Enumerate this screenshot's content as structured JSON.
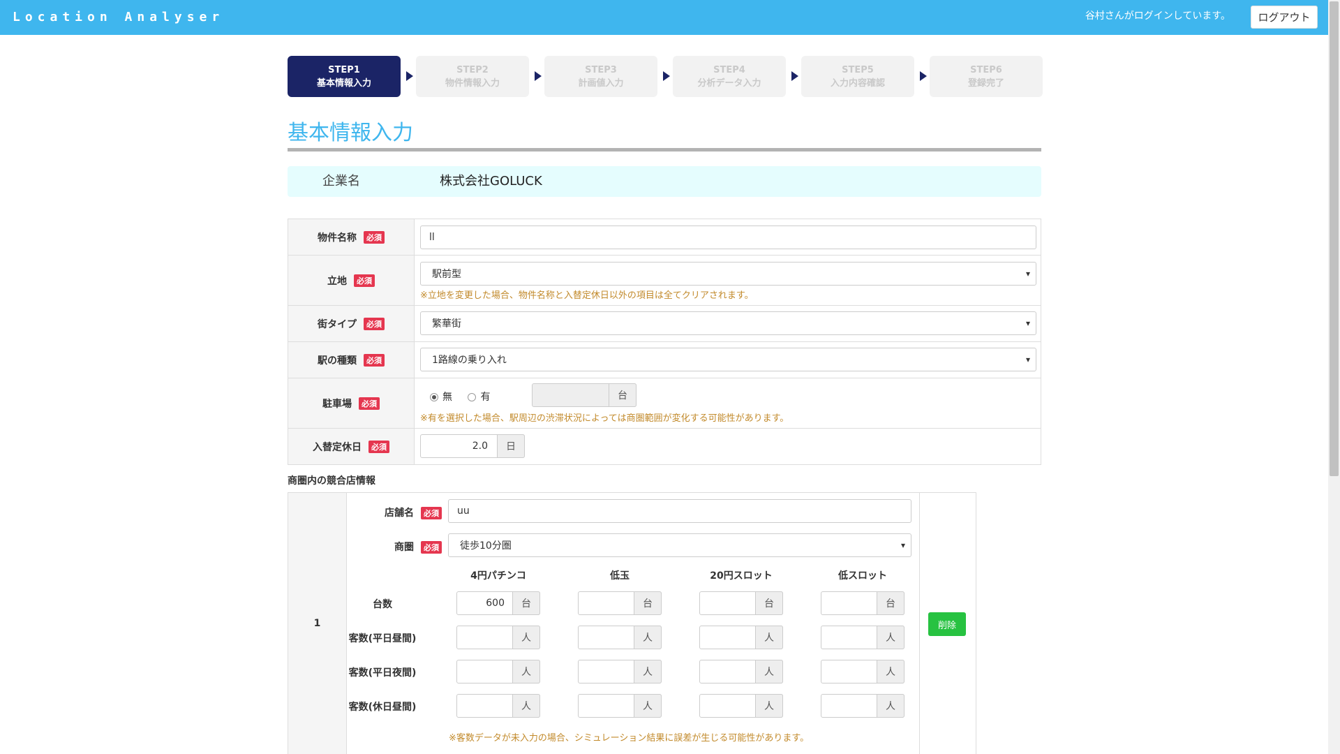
{
  "header": {
    "logo": "Location Analyser",
    "login_text": "谷村さんがログインしています。",
    "logout_label": "ログアウト"
  },
  "steps": [
    {
      "num": "STEP1",
      "label": "基本情報入力",
      "active": true
    },
    {
      "num": "STEP2",
      "label": "物件情報入力",
      "active": false
    },
    {
      "num": "STEP3",
      "label": "計画値入力",
      "active": false
    },
    {
      "num": "STEP4",
      "label": "分析データ入力",
      "active": false
    },
    {
      "num": "STEP5",
      "label": "入力内容確認",
      "active": false
    },
    {
      "num": "STEP6",
      "label": "登録完了",
      "active": false
    }
  ],
  "page_title": "基本情報入力",
  "company": {
    "label": "企業名",
    "value": "株式会社GOLUCK"
  },
  "required_badge": "必須",
  "form": {
    "property_name": {
      "label": "物件名称",
      "value": "ll"
    },
    "location": {
      "label": "立地",
      "value": "駅前型",
      "note": "※立地を変更した場合、物件名称と入替定休日以外の項目は全てクリアされます。"
    },
    "town_type": {
      "label": "街タイプ",
      "value": "繁華街"
    },
    "station_type": {
      "label": "駅の種類",
      "value": "1路線の乗り入れ"
    },
    "parking": {
      "label": "駐車場",
      "option_no": "無",
      "option_yes": "有",
      "selected": "無",
      "count": "",
      "unit": "台",
      "note": "※有を選択した場合、駅周辺の渋滞状況によっては商圏範囲が変化する可能性があります。"
    },
    "holiday": {
      "label": "入替定休日",
      "value": "2.0",
      "unit": "日"
    }
  },
  "competitor": {
    "section_title": "商圏内の競合店情報",
    "index": "1",
    "store_name_label": "店舗名",
    "store_name": "uu",
    "area_label": "商圏",
    "area_value": "徒歩10分圏",
    "columns": [
      "4円パチンコ",
      "低玉",
      "20円スロット",
      "低スロット"
    ],
    "rows": [
      {
        "label": "台数",
        "unit": "台",
        "values": [
          "600",
          "",
          "",
          ""
        ]
      },
      {
        "label": "客数(平日昼間)",
        "unit": "人",
        "values": [
          "",
          "",
          "",
          ""
        ]
      },
      {
        "label": "客数(平日夜間)",
        "unit": "人",
        "values": [
          "",
          "",
          "",
          ""
        ]
      },
      {
        "label": "客数(休日昼間)",
        "unit": "人",
        "values": [
          "",
          "",
          "",
          ""
        ]
      }
    ],
    "delete_label": "削除",
    "note": "※客数データが未入力の場合、シミュレーション結果に誤差が生じる可能性があります。"
  }
}
